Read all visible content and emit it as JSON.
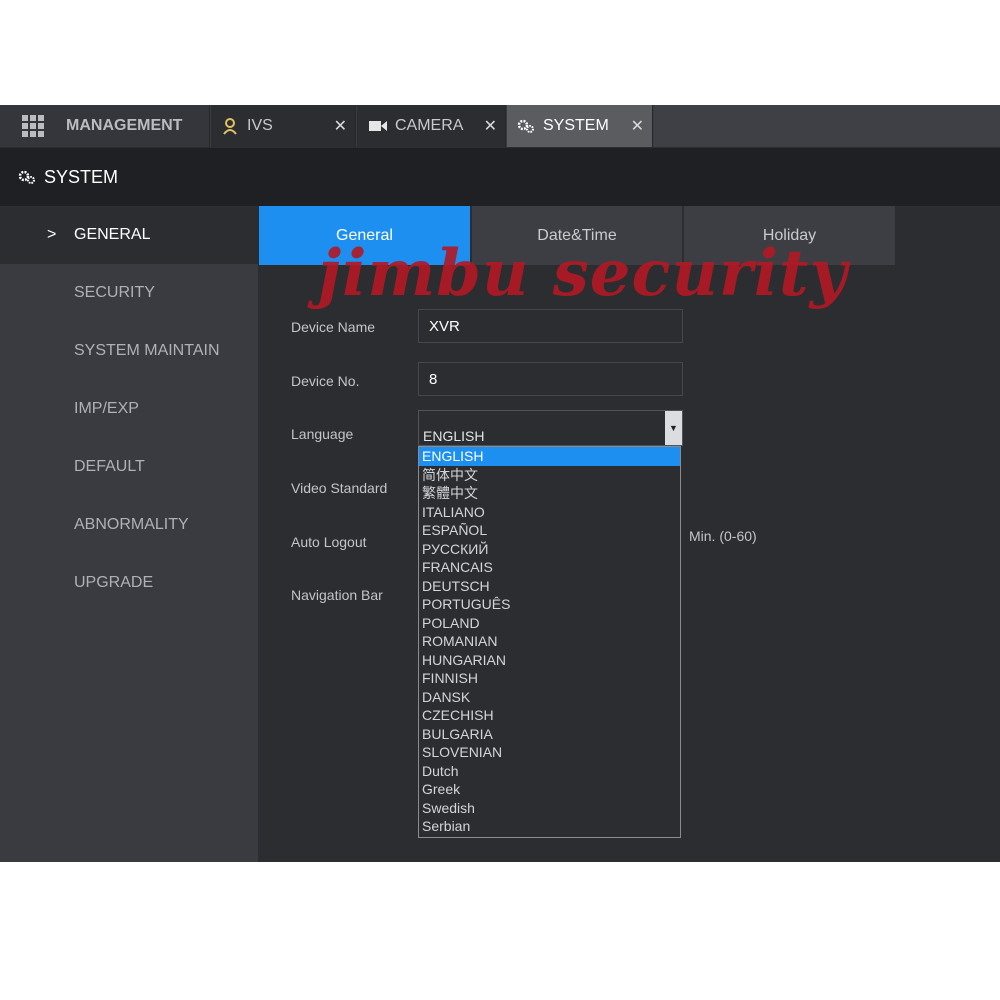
{
  "top_tabs": {
    "management": "MANAGEMENT",
    "ivs": "IVS",
    "camera": "CAMERA",
    "system": "SYSTEM",
    "close": "✕"
  },
  "header": {
    "title": "SYSTEM"
  },
  "sidebar": {
    "items": [
      {
        "label": "GENERAL"
      },
      {
        "label": "SECURITY"
      },
      {
        "label": "SYSTEM MAINTAIN"
      },
      {
        "label": "IMP/EXP"
      },
      {
        "label": "DEFAULT"
      },
      {
        "label": "ABNORMALITY"
      },
      {
        "label": "UPGRADE"
      }
    ],
    "active_chevron": ">"
  },
  "subtabs": [
    "General",
    "Date&Time",
    "Holiday"
  ],
  "form": {
    "device_name_label": "Device Name",
    "device_name_value": "XVR",
    "device_no_label": "Device No.",
    "device_no_value": "8",
    "language_label": "Language",
    "language_value": "ENGLISH",
    "video_standard_label": "Video Standard",
    "auto_logout_label": "Auto Logout",
    "auto_logout_unit": "Min. (0-60)",
    "navigation_bar_label": "Navigation Bar"
  },
  "language_options": [
    "ENGLISH",
    "简体中文",
    "繁體中文",
    "ITALIANO",
    "ESPAÑOL",
    "РУССКИЙ",
    "FRANCAIS",
    "DEUTSCH",
    "PORTUGUÊS",
    "POLAND",
    "ROMANIAN",
    "HUNGARIAN",
    "FINNISH",
    "DANSK",
    "CZECHISH",
    "BULGARIA",
    "SLOVENIAN",
    "Dutch",
    "Greek",
    "Swedish",
    "Serbian"
  ],
  "watermark": "jimbu security",
  "colors": {
    "accent": "#1d8ff0",
    "watermark": "#b21824",
    "background": "#2b2d31"
  }
}
